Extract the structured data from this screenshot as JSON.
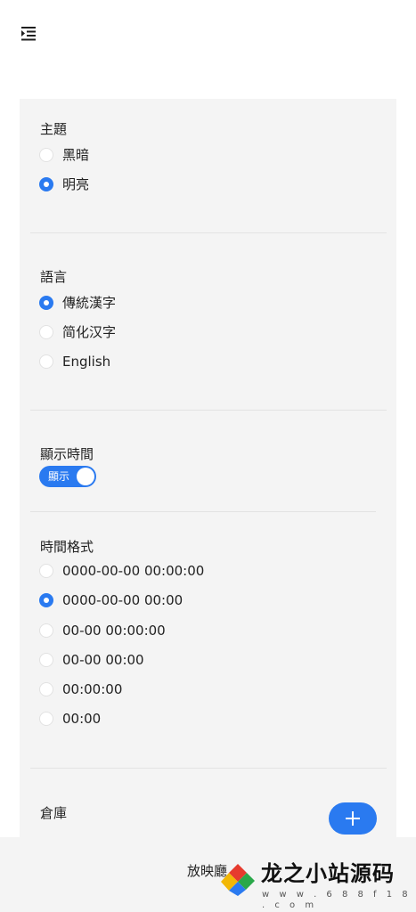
{
  "header": {
    "menu_icon": "indent-menu-icon"
  },
  "theme": {
    "title": "主題",
    "options": [
      {
        "label": "黑暗",
        "checked": false
      },
      {
        "label": "明亮",
        "checked": true
      }
    ]
  },
  "language": {
    "title": "語言",
    "options": [
      {
        "label": "傳統漢字",
        "checked": true
      },
      {
        "label": "简化汉字",
        "checked": false
      },
      {
        "label": "English",
        "checked": false
      }
    ]
  },
  "show_time": {
    "title": "顯示時間",
    "toggle_label": "顯示",
    "on": true
  },
  "time_format": {
    "title": "時間格式",
    "options": [
      {
        "label": "0000-00-00 00:00:00",
        "checked": false
      },
      {
        "label": "0000-00-00 00:00",
        "checked": true
      },
      {
        "label": "00-00 00:00:00",
        "checked": false
      },
      {
        "label": "00-00 00:00",
        "checked": false
      },
      {
        "label": "00:00:00",
        "checked": false
      },
      {
        "label": "00:00",
        "checked": false
      }
    ]
  },
  "repository": {
    "title": "倉庫",
    "add_icon": "plus-icon"
  },
  "bottom_bar": {
    "label": "放映廳"
  },
  "watermark": {
    "title": "龙之小站源码",
    "url": "w w w . 6 8 8 f 1 8 . c o m"
  },
  "colors": {
    "accent": "#2a7af0",
    "panel": "#f4f4f4"
  }
}
